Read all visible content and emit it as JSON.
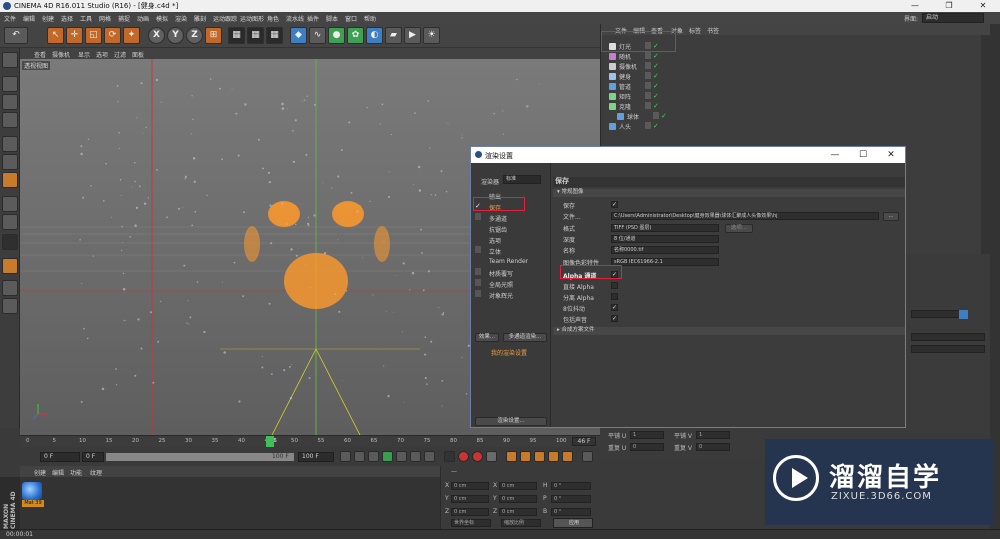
{
  "app": {
    "title": "CINEMA 4D R16.011 Studio (R16) - [健身.c4d *]",
    "win_min": "—",
    "win_max": "❐",
    "win_close": "✕"
  },
  "menu": [
    "文件",
    "编辑",
    "创建",
    "选择",
    "工具",
    "网格",
    "捕捉",
    "动画",
    "模拟",
    "渲染",
    "雕刻",
    "运动跟踪",
    "运动图形",
    "角色",
    "流水线",
    "插件",
    "脚本",
    "窗口",
    "帮助"
  ],
  "layout": {
    "label": "界面:",
    "value": "启动"
  },
  "viewport": {
    "menu": [
      "查看",
      "摄像机",
      "显示",
      "选项",
      "过滤",
      "面板"
    ],
    "label": "透视视图"
  },
  "timeline": {
    "ticks": [
      "0",
      "5",
      "10",
      "15",
      "20",
      "25",
      "30",
      "35",
      "40",
      "45",
      "46",
      "50",
      "55",
      "60",
      "65",
      "70",
      "75",
      "80",
      "85",
      "90",
      "95",
      "100"
    ],
    "current": "46",
    "end_frame": "46 F"
  },
  "playbar": {
    "start": "0 F",
    "field2": "0 F",
    "range_end": "100 F",
    "end": "100 F"
  },
  "material": {
    "menu": [
      "创建",
      "编辑",
      "功能",
      "纹理"
    ],
    "name": "Mat 39"
  },
  "brand": "MAXON CINEMA 4D",
  "coords": {
    "header": "—",
    "labels": [
      "X",
      "Y",
      "Z"
    ],
    "pos": [
      "0 cm",
      "0 cm",
      "0 cm"
    ],
    "size": [
      "0 cm",
      "0 cm",
      "0 cm"
    ],
    "rot_labels": [
      "H",
      "P",
      "B"
    ],
    "rot": [
      "0 °",
      "0 °",
      "0 °"
    ],
    "mode1": "世界坐标",
    "mode2": "缩放比例",
    "apply": "应用"
  },
  "status": "00:00:01",
  "objects": {
    "menu": [
      "文件",
      "编辑",
      "查看",
      "对象",
      "标签",
      "书签"
    ],
    "items": [
      {
        "name": "灯光",
        "color": "#dddddd"
      },
      {
        "name": "随机",
        "color": "#c97dd1"
      },
      {
        "name": "摄像机",
        "color": "#cccccc"
      },
      {
        "name": "健身",
        "color": "#9cc2e8"
      },
      {
        "name": "管道",
        "color": "#5ea0e0"
      },
      {
        "name": "矩阵",
        "color": "#7bd487"
      },
      {
        "name": "克隆",
        "color": "#7bd487"
      },
      {
        "name": "球体",
        "color": "#5ea0e0"
      },
      {
        "name": "人头",
        "color": "#5ea0e0"
      }
    ]
  },
  "attrs": {
    "u_label": "平铺 U",
    "u_val": "1",
    "v_label": "平铺 V",
    "v_val": "1",
    "ru_label": "重复 U",
    "ru_val": "0",
    "rv_label": "重复 V",
    "rv_val": "0"
  },
  "logo": {
    "title": "溜溜自学",
    "url": "ZIXUE.3D66.COM"
  },
  "dialog": {
    "title": "渲染设置",
    "renderer_label": "渲染器",
    "renderer_value": "标准",
    "items": [
      "输出",
      "保存",
      "多通道",
      "抗锯齿",
      "选项",
      "立体",
      "Team Render",
      "材质覆写",
      "全局光照",
      "对象辉光"
    ],
    "btn_effect": "效果...",
    "btn_multi": "多通道渲染...",
    "my_settings": "我的渲染设置",
    "btn_render_settings": "渲染设置...",
    "save_header": "保存",
    "section_image": "▾ 常规图像",
    "section_composite": "▸ 合成方案文件",
    "save_label": "保存",
    "file_label": "文件...",
    "file_value": "C:\\Users\\Administrator\\Desktop\\健身效果器\\球体汇聚成人头像效果\\hj",
    "file_btn": "...",
    "format_label": "格式",
    "format_value": "TIFF (PSD 图层)",
    "options_btn": "选项...",
    "depth_label": "深度",
    "depth_value": "8 位/通道",
    "name_label": "名称",
    "name_value": "名称0000.tif",
    "profile_label": "图像色彩特性",
    "profile_value": "sRGB IEC61966-2.1",
    "alpha_label": "Alpha 通道",
    "straight_label": "直接 Alpha",
    "separate_label": "分离 Alpha",
    "dither_label": "8位抖动",
    "sound_label": "包括声音"
  }
}
